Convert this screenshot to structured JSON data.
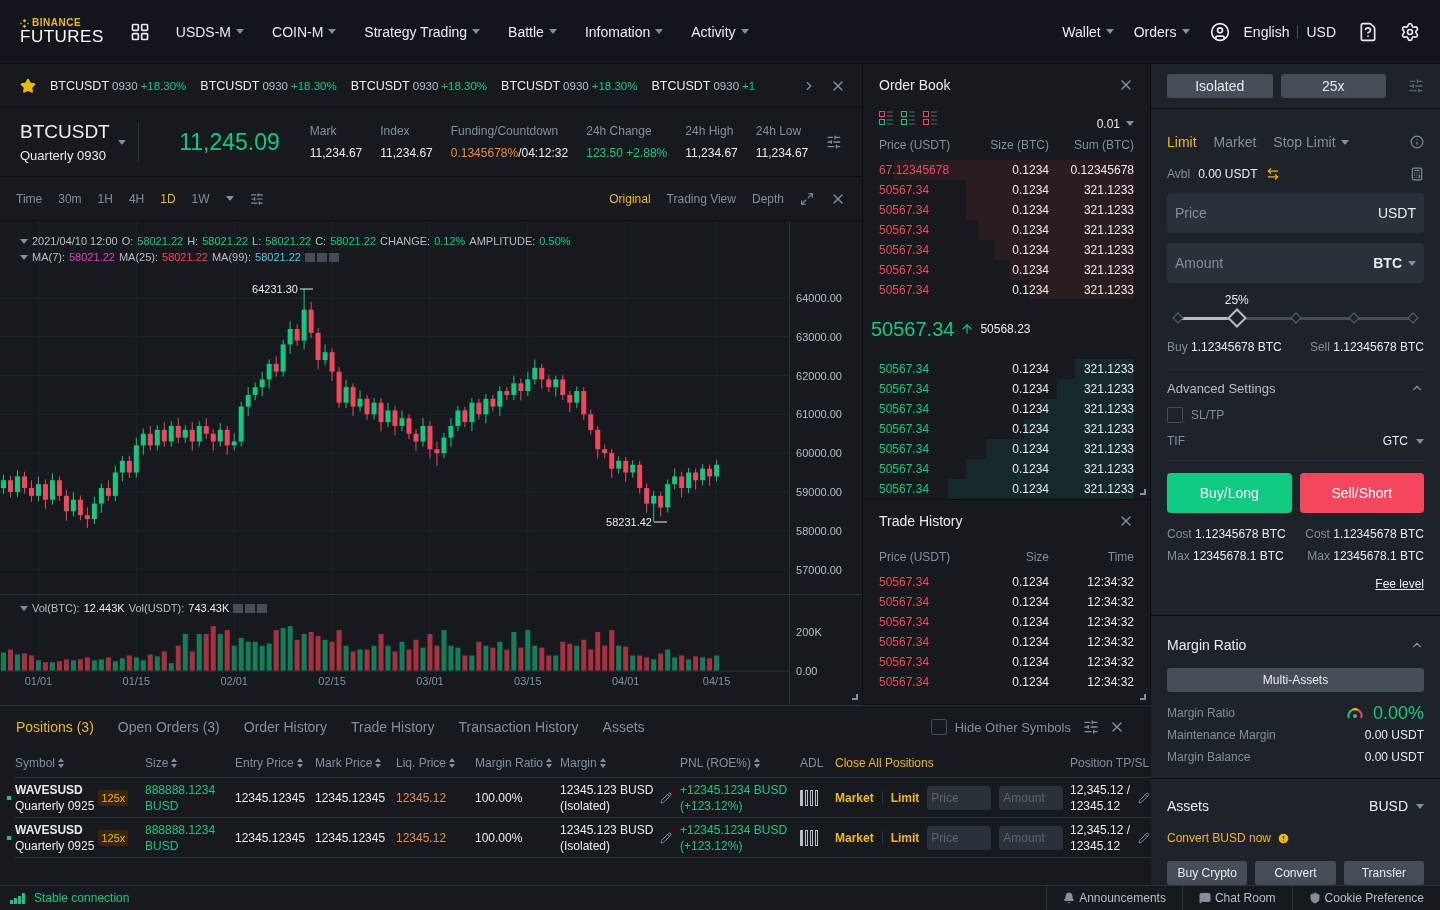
{
  "header": {
    "logo": {
      "top": "BINANCE",
      "bottom": "FUTURES"
    },
    "nav": [
      {
        "label": "USDS-M",
        "dropdown": true
      },
      {
        "label": "COIN-M",
        "dropdown": true
      },
      {
        "label": "Strategy Trading",
        "dropdown": true
      },
      {
        "label": "Battle",
        "dropdown": true
      },
      {
        "label": "Infomation",
        "dropdown": true
      },
      {
        "label": "Activity",
        "dropdown": true
      }
    ],
    "menus": [
      {
        "label": "Wallet",
        "dropdown": true
      },
      {
        "label": "Orders",
        "dropdown": true
      }
    ],
    "language": "English",
    "currency": "USD"
  },
  "ticker": {
    "favorite": true,
    "items": [
      {
        "symbol": "BTCUSDT",
        "contract": "0930",
        "change": "+18.30%"
      },
      {
        "symbol": "BTCUSDT",
        "contract": "0930",
        "change": "+18.30%"
      },
      {
        "symbol": "BTCUSDT",
        "contract": "0930",
        "change": "+18.30%"
      },
      {
        "symbol": "BTCUSDT",
        "contract": "0930",
        "change": "+18.30%"
      },
      {
        "symbol": "BTCUSDT",
        "contract": "0930",
        "change": "+1"
      }
    ]
  },
  "symbol_info": {
    "symbol": "BTCUSDT",
    "contract": "Quarterly 0930",
    "last_price": "11,245.09",
    "stats": [
      {
        "label": "Mark",
        "value": "11,234.67",
        "color": "#eaecef"
      },
      {
        "label": "Index",
        "value": "11,234.67",
        "color": "#eaecef"
      },
      {
        "label": "Funding/Countdown",
        "value": "0.1345678%",
        "suffix": "/04:12:32",
        "color": "#f0883e"
      },
      {
        "label": "24h Change",
        "value": "123.50 +2.88%",
        "color": "#0ecb81"
      },
      {
        "label": "24h High",
        "value": "11,234.67",
        "color": "#eaecef"
      },
      {
        "label": "24h Low",
        "value": "11,234.67",
        "color": "#eaecef"
      }
    ]
  },
  "chart_toolbar": {
    "intervals": [
      {
        "label": "Time",
        "selected": false
      },
      {
        "label": "30m",
        "selected": false
      },
      {
        "label": "1H",
        "selected": false
      },
      {
        "label": "4H",
        "selected": false
      },
      {
        "label": "1D",
        "selected": true
      },
      {
        "label": "1W",
        "selected": false
      }
    ],
    "views": [
      {
        "label": "Original",
        "selected": true
      },
      {
        "label": "Trading View",
        "selected": false
      },
      {
        "label": "Depth",
        "selected": false
      }
    ]
  },
  "chart": {
    "date": "2021/04/10 12:00",
    "legend": [
      {
        "label": "O:",
        "value": "58021.22"
      },
      {
        "label": "H:",
        "value": "58021.22"
      },
      {
        "label": "L:",
        "value": "58021.22"
      },
      {
        "label": "C:",
        "value": "58021.22"
      },
      {
        "label": "CHANGE:",
        "value": "0.12%"
      },
      {
        "label": "AMPLITUDE:",
        "value": "0.50%"
      }
    ],
    "ma": [
      {
        "label": "MA(7):",
        "value": "58021.22",
        "color": "#e23ec8"
      },
      {
        "label": "MA(25):",
        "value": "58021.22",
        "color": "#f6465d"
      },
      {
        "label": "MA(99):",
        "value": "58021.22",
        "color": "#3fd0e8"
      }
    ],
    "high_label": "64231.30",
    "low_label": "58231.42",
    "candles": {
      "chart_data": {
        "type": "candlestick",
        "categories": [
          null,
          null,
          null,
          null,
          null,
          null,
          null,
          null,
          null,
          null,
          null,
          null,
          null,
          null,
          null,
          null,
          null,
          null,
          null,
          null,
          null,
          null,
          null,
          null,
          null,
          null,
          null,
          null,
          null,
          null,
          null,
          null,
          null,
          null,
          null,
          null,
          null,
          null,
          null,
          null,
          null,
          null,
          null,
          null,
          null,
          null,
          null,
          null,
          null,
          null,
          null,
          null,
          null,
          null,
          null,
          null,
          null,
          null,
          null,
          null,
          null,
          null,
          null,
          null,
          null,
          null,
          null,
          null,
          null,
          null,
          null,
          null,
          null,
          null,
          null,
          null,
          null,
          null,
          null,
          null,
          null,
          null,
          null,
          null,
          null,
          null,
          null,
          null,
          null,
          null,
          null,
          null,
          null,
          null,
          null,
          null,
          null,
          null,
          null,
          null,
          null,
          null,
          null,
          null,
          null,
          null,
          null,
          null,
          null,
          null,
          null,
          null,
          null
        ],
        "ohlc": [
          [
            59100,
            59450,
            58950,
            59300
          ],
          [
            59300,
            59420,
            58860,
            59000
          ],
          [
            59000,
            59560,
            58870,
            59400
          ],
          [
            59400,
            59520,
            58960,
            59100
          ],
          [
            59100,
            59300,
            58750,
            58900
          ],
          [
            58900,
            59390,
            58760,
            59200
          ],
          [
            59200,
            59320,
            58560,
            58800
          ],
          [
            58800,
            59480,
            58670,
            59300
          ],
          [
            59300,
            59400,
            58770,
            58900
          ],
          [
            58900,
            59050,
            58260,
            58500
          ],
          [
            58500,
            58990,
            58370,
            58800
          ],
          [
            58800,
            58910,
            58270,
            58400
          ],
          [
            58400,
            58600,
            58070,
            58300
          ],
          [
            58300,
            58880,
            58170,
            58700
          ],
          [
            58700,
            59220,
            58460,
            59100
          ],
          [
            59100,
            59300,
            58770,
            58900
          ],
          [
            58900,
            59680,
            58760,
            59500
          ],
          [
            59500,
            59920,
            59270,
            59800
          ],
          [
            59800,
            59930,
            59360,
            59500
          ],
          [
            59500,
            60400,
            59370,
            60200
          ],
          [
            60200,
            60630,
            59960,
            60500
          ],
          [
            60500,
            60700,
            60070,
            60200
          ],
          [
            60200,
            60720,
            60070,
            60600
          ],
          [
            60600,
            60800,
            60160,
            60300
          ],
          [
            60300,
            60820,
            60170,
            60700
          ],
          [
            60700,
            60900,
            60260,
            60400
          ],
          [
            60400,
            60720,
            60270,
            60600
          ],
          [
            60600,
            60800,
            60060,
            60300
          ],
          [
            60300,
            60820,
            60170,
            60700
          ],
          [
            60700,
            60900,
            60370,
            60500
          ],
          [
            60500,
            60620,
            60060,
            60300
          ],
          [
            60300,
            60780,
            60170,
            60600
          ],
          [
            60600,
            60700,
            59960,
            60200
          ],
          [
            60200,
            60520,
            60070,
            60300
          ],
          [
            60300,
            61320,
            60170,
            61200
          ],
          [
            61200,
            61700,
            60960,
            61500
          ],
          [
            61500,
            61820,
            61370,
            61700
          ],
          [
            61700,
            62100,
            61470,
            61900
          ],
          [
            61900,
            62420,
            61660,
            62300
          ],
          [
            62300,
            62500,
            61970,
            62100
          ],
          [
            62100,
            62920,
            61970,
            62800
          ],
          [
            62800,
            63400,
            62560,
            63200
          ],
          [
            63200,
            63320,
            62770,
            62900
          ],
          [
            62900,
            64230,
            62670,
            63700
          ],
          [
            63700,
            63900,
            62970,
            63100
          ],
          [
            63100,
            63220,
            62160,
            62400
          ],
          [
            62400,
            62800,
            62270,
            62600
          ],
          [
            62600,
            62700,
            61860,
            62100
          ],
          [
            62100,
            62220,
            61170,
            61300
          ],
          [
            61300,
            61900,
            61160,
            61700
          ],
          [
            61700,
            61800,
            60960,
            61200
          ],
          [
            61200,
            61620,
            61070,
            61400
          ],
          [
            61400,
            61500,
            60860,
            61000
          ],
          [
            61000,
            61420,
            60870,
            61300
          ],
          [
            61300,
            61420,
            60560,
            60800
          ],
          [
            60800,
            61300,
            60670,
            61100
          ],
          [
            61100,
            61220,
            60460,
            60700
          ],
          [
            60700,
            61100,
            60570,
            60900
          ],
          [
            60900,
            61000,
            60360,
            60500
          ],
          [
            60500,
            60620,
            60060,
            60300
          ],
          [
            60300,
            60900,
            60170,
            60700
          ],
          [
            60700,
            60820,
            59860,
            60100
          ],
          [
            60100,
            60300,
            59670,
            60000
          ],
          [
            60000,
            60520,
            59870,
            60400
          ],
          [
            60400,
            60900,
            60160,
            60700
          ],
          [
            60700,
            61220,
            60570,
            61100
          ],
          [
            61100,
            61200,
            60670,
            60800
          ],
          [
            60800,
            61420,
            60570,
            61300
          ],
          [
            61300,
            61400,
            60870,
            61000
          ],
          [
            61000,
            61520,
            60770,
            61400
          ],
          [
            61400,
            61500,
            61070,
            61200
          ],
          [
            61200,
            61720,
            60960,
            61600
          ],
          [
            61600,
            61700,
            61370,
            61500
          ],
          [
            61500,
            62000,
            61370,
            61800
          ],
          [
            61800,
            61920,
            61360,
            61600
          ],
          [
            61600,
            62100,
            61470,
            61900
          ],
          [
            61900,
            62420,
            61770,
            62200
          ],
          [
            62200,
            62300,
            61660,
            61900
          ],
          [
            61900,
            62020,
            61570,
            61700
          ],
          [
            61700,
            62000,
            61460,
            61900
          ],
          [
            61900,
            62020,
            61370,
            61500
          ],
          [
            61500,
            61600,
            61060,
            61300
          ],
          [
            61300,
            61720,
            61170,
            61600
          ],
          [
            61600,
            61700,
            60860,
            61000
          ],
          [
            61000,
            61120,
            60470,
            60600
          ],
          [
            60600,
            60700,
            59860,
            60100
          ],
          [
            60100,
            60220,
            59870,
            60000
          ],
          [
            60000,
            60100,
            59360,
            59600
          ],
          [
            59600,
            59920,
            59470,
            59800
          ],
          [
            59800,
            59900,
            59260,
            59500
          ],
          [
            59500,
            59820,
            59370,
            59700
          ],
          [
            59700,
            59800,
            58960,
            59100
          ],
          [
            59100,
            59220,
            58470,
            58700
          ],
          [
            58700,
            59020,
            58230,
            58900
          ],
          [
            58900,
            59000,
            58370,
            58600
          ],
          [
            58600,
            59320,
            58470,
            59200
          ],
          [
            59200,
            59600,
            59070,
            59400
          ],
          [
            59400,
            59520,
            58860,
            59100
          ],
          [
            59100,
            59620,
            58970,
            59500
          ],
          [
            59500,
            59600,
            59060,
            59300
          ],
          [
            59300,
            59720,
            59170,
            59600
          ],
          [
            59600,
            59700,
            59160,
            59400
          ],
          [
            59400,
            59820,
            59270,
            59700
          ],
          null,
          null,
          null,
          null,
          null,
          null,
          null,
          null,
          null,
          null
        ],
        "ylim": [
          56369,
          65983.5
        ],
        "grid": true,
        "yticks": [
          {
            "value": 64000,
            "label": "64000.00"
          },
          {
            "value": 63000,
            "label": "63000.00"
          },
          {
            "value": 62000,
            "label": "62000.00"
          },
          {
            "value": 61000,
            "label": "61000.00"
          },
          {
            "value": 60000,
            "label": "60000.00"
          },
          {
            "value": 59000,
            "label": "59000.00"
          },
          {
            "value": 58000,
            "label": "58000.00"
          },
          {
            "value": 57000,
            "label": "57000.00"
          }
        ]
      }
    },
    "volume_legend": [
      {
        "label": "Vol(BTC):",
        "value": "12.443K"
      },
      {
        "label": "Vol(USDT):",
        "value": "743.43K"
      }
    ],
    "volume": {
      "chart_data": {
        "type": "bar",
        "ylim": [
          0,
          389700
        ],
        "grid": true,
        "categories": [
          null,
          null,
          null,
          null,
          null,
          "01/01",
          null,
          null,
          null,
          null,
          null,
          null,
          null,
          null,
          null,
          null,
          null,
          null,
          null,
          "01/15",
          null,
          null,
          null,
          null,
          null,
          null,
          null,
          null,
          null,
          null,
          null,
          null,
          null,
          "02/01",
          null,
          null,
          null,
          null,
          null,
          null,
          null,
          null,
          null,
          null,
          null,
          null,
          null,
          "02/15",
          null,
          null,
          null,
          null,
          null,
          null,
          null,
          null,
          null,
          null,
          null,
          null,
          null,
          "03/01",
          null,
          null,
          null,
          null,
          null,
          null,
          null,
          null,
          null,
          null,
          null,
          null,
          null,
          "03/15",
          null,
          null,
          null,
          null,
          null,
          null,
          null,
          null,
          null,
          null,
          null,
          null,
          null,
          "04/01",
          null,
          null,
          null,
          null,
          null,
          null,
          null,
          null,
          null,
          null,
          null,
          null,
          "04/15",
          null,
          null,
          null,
          null,
          null,
          null,
          null,
          null,
          null,
          null
        ],
        "series": [
          {
            "color": "#10805a",
            "values": [
              95000,
              null,
              85000,
              null,
              null,
              55000,
              null,
              45000,
              null,
              null,
              55000,
              null,
              null,
              55000,
              60000,
              null,
              50000,
              65000,
              null,
              70000,
              55000,
              null,
              75000,
              null,
              40000,
              null,
              190000,
              null,
              190000,
              null,
              null,
              190000,
              null,
              130000,
              170000,
              150000,
              150000,
              130000,
              140000,
              null,
              220000,
              230000,
              null,
              190000,
              null,
              null,
              160000,
              null,
              null,
              130000,
              null,
              110000,
              null,
              130000,
              null,
              130000,
              null,
              150000,
              null,
              null,
              120000,
              null,
              null,
              210000,
              130000,
              120000,
              null,
              80000,
              null,
              130000,
              null,
              150000,
              null,
              200000,
              null,
              210000,
              130000,
              null,
              null,
              80000,
              null,
              null,
              130000,
              null,
              null,
              null,
              null,
              null,
              130000,
              null,
              80000,
              null,
              null,
              60000,
              null,
              110000,
              70000,
              null,
              60000,
              null,
              70000,
              null,
              80000,
              null,
              null,
              null,
              null,
              null,
              null,
              null,
              null,
              null,
              null
            ]
          },
          {
            "color": "#a8303f",
            "values": [
              null,
              110000,
              null,
              90000,
              80000,
              null,
              45000,
              null,
              50000,
              60000,
              null,
              60000,
              70000,
              null,
              null,
              70000,
              null,
              null,
              80000,
              null,
              null,
              85000,
              null,
              100000,
              null,
              130000,
              null,
              100000,
              null,
              190000,
              230000,
              null,
              210000,
              null,
              null,
              null,
              null,
              null,
              null,
              210000,
              null,
              null,
              160000,
              null,
              200000,
              180000,
              null,
              150000,
              210000,
              null,
              100000,
              null,
              110000,
              null,
              190000,
              null,
              100000,
              null,
              110000,
              160000,
              null,
              190000,
              130000,
              null,
              null,
              null,
              80000,
              null,
              150000,
              null,
              120000,
              null,
              110000,
              null,
              120000,
              null,
              null,
              120000,
              80000,
              null,
              150000,
              140000,
              null,
              160000,
              110000,
              200000,
              130000,
              210000,
              null,
              125000,
              null,
              80000,
              70000,
              null,
              90000,
              null,
              null,
              80000,
              null,
              75000,
              null,
              65000,
              null,
              null,
              null,
              null,
              null,
              null,
              null,
              null,
              null,
              null,
              null
            ]
          }
        ],
        "yticks": [
          {
            "value": 200000,
            "label": "200K"
          },
          {
            "value": 0,
            "label": "0.00"
          }
        ]
      }
    }
  },
  "order_book": {
    "title": "Order Book",
    "precision": "0.01",
    "columns": [
      "Price (USDT)",
      "Size (BTC)",
      "Sum (BTC)"
    ],
    "asks": [
      {
        "price": "67.12345678",
        "size": "0.1234",
        "sum": "0.12345678"
      },
      {
        "price": "50567.34",
        "size": "0.1234",
        "sum": "321.1233"
      },
      {
        "price": "50567.34",
        "size": "0.1234",
        "sum": "321.1233"
      },
      {
        "price": "50567.34",
        "size": "0.1234",
        "sum": "321.1233"
      },
      {
        "price": "50567.34",
        "size": "0.1234",
        "sum": "321.1233"
      },
      {
        "price": "50567.34",
        "size": "0.1234",
        "sum": "321.1233"
      },
      {
        "price": "50567.34",
        "size": "0.1234",
        "sum": "321.1233"
      }
    ],
    "last_price": "50567.34",
    "mark_price": "50568.23",
    "bids": [
      {
        "price": "50567.34",
        "size": "0.1234",
        "sum": "321.1233"
      },
      {
        "price": "50567.34",
        "size": "0.1234",
        "sum": "321.1233"
      },
      {
        "price": "50567.34",
        "size": "0.1234",
        "sum": "321.1233"
      },
      {
        "price": "50567.34",
        "size": "0.1234",
        "sum": "321.1233"
      },
      {
        "price": "50567.34",
        "size": "0.1234",
        "sum": "321.1233"
      },
      {
        "price": "50567.34",
        "size": "0.1234",
        "sum": "321.1233"
      },
      {
        "price": "50567.34",
        "size": "0.1234",
        "sum": "321.1233"
      }
    ]
  },
  "trade_history": {
    "title": "Trade History",
    "columns": [
      "Price (USDT)",
      "Size",
      "Time"
    ],
    "rows": [
      {
        "price": "50567.34",
        "size": "0.1234",
        "time": "12:34:32"
      },
      {
        "price": "50567.34",
        "size": "0.1234",
        "time": "12:34:32"
      },
      {
        "price": "50567.34",
        "size": "0.1234",
        "time": "12:34:32"
      },
      {
        "price": "50567.34",
        "size": "0.1234",
        "time": "12:34:32"
      },
      {
        "price": "50567.34",
        "size": "0.1234",
        "time": "12:34:32"
      },
      {
        "price": "50567.34",
        "size": "0.1234",
        "time": "12:34:32"
      }
    ]
  },
  "order_form": {
    "margin_mode": "Isolated",
    "leverage": "25x",
    "order_types": [
      {
        "label": "Limit",
        "selected": true,
        "dropdown": false
      },
      {
        "label": "Market",
        "selected": false,
        "dropdown": false
      },
      {
        "label": "Stop Limit",
        "selected": false,
        "dropdown": true
      }
    ],
    "available_label": "Avbl",
    "available": "0.00 USDT",
    "price_field": {
      "placeholder": "Price",
      "unit": "USDT"
    },
    "amount_field": {
      "placeholder": "Amount",
      "unit": "BTC"
    },
    "slider": {
      "level": 0.25,
      "reading": "25%"
    },
    "buy_label": "Buy",
    "buy_value": "1.12345678 BTC",
    "sell_label": "Sell",
    "sell_value": "1.12345678 BTC",
    "advanced": {
      "title": "Advanced Settings",
      "expanded": true
    },
    "sltp": {
      "label": "SL/TP",
      "checked": false
    },
    "tif": {
      "label": "TIF",
      "value": "GTC"
    },
    "buy_button": "Buy/Long",
    "sell_button": "Sell/Short",
    "costs": [
      {
        "label": "Cost",
        "value": "1.12345678 BTC"
      },
      {
        "label": "Cost",
        "value": "1.12345678 BTC"
      }
    ],
    "maxes": [
      {
        "label": "Max",
        "value": "12345678.1 BTC"
      },
      {
        "label": "Max",
        "value": "12345678.1 BTC"
      }
    ],
    "fee_link": "Fee level"
  },
  "margin_ratio": {
    "title": "Margin Ratio",
    "expanded": true,
    "mode_button": "Multi-Assets",
    "rows": [
      {
        "label": "Margin Ratio",
        "value": "0.00%",
        "kind": "ratio"
      },
      {
        "label": "Maintenance Margin",
        "value": "0.00 USDT",
        "kind": "plain"
      },
      {
        "label": "Margin Balance",
        "value": "0.00 USDT",
        "kind": "plain"
      }
    ]
  },
  "assets": {
    "title": "Assets",
    "currency": "BUSD",
    "convert_link": "Convert BUSD now",
    "buttons": [
      "Buy Crypto",
      "Convert",
      "Transfer"
    ]
  },
  "positions": {
    "tabs": [
      {
        "label": "Positions (3)",
        "selected": true
      },
      {
        "label": "Open Orders (3)",
        "selected": false
      },
      {
        "label": "Order History",
        "selected": false
      },
      {
        "label": "Trade History",
        "selected": false
      },
      {
        "label": "Transaction History",
        "selected": false
      },
      {
        "label": "Assets",
        "selected": false
      }
    ],
    "hide_other": {
      "label": "Hide Other Symbols",
      "checked": false
    },
    "columns": [
      {
        "label": "Symbol",
        "kind": "sort"
      },
      {
        "label": "Size",
        "kind": "sort"
      },
      {
        "label": "Entry Price",
        "kind": "sort"
      },
      {
        "label": "Mark Price",
        "kind": "sort"
      },
      {
        "label": "Liq. Price",
        "kind": "sort"
      },
      {
        "label": "Margin Ratio",
        "kind": "sort"
      },
      {
        "label": "Margin",
        "kind": "sort"
      },
      {
        "label": "PNL (ROE%)",
        "kind": "sort"
      },
      {
        "label": "ADL",
        "kind": "plain"
      },
      {
        "label": "Close All Positions",
        "kind": "link"
      },
      {
        "label": "Position TP/SL",
        "kind": "plain"
      }
    ],
    "rows": [
      {
        "symbol": "WAVESUSD",
        "contract": "Quarterly 0925",
        "leverage": "125x",
        "size": "888888.1234 BUSD",
        "entry": "12345.12345",
        "mark": "12345.12345",
        "liq": "12345.12",
        "ratio": "100.00%",
        "margin": "12345.123 BUSD (Isolated)",
        "pnl": "+12345.1234 BUSD (+123.12%)",
        "market": "Market",
        "limit": "Limit",
        "price_placeholder": "Price",
        "amount_placeholder": "Amount",
        "tpsl": "12,345.12 / 12345.12"
      },
      {
        "symbol": "WAVESUSD",
        "contract": "Quarterly 0925",
        "leverage": "125x",
        "size": "888888.1234 BUSD",
        "entry": "12345.12345",
        "mark": "12345.12345",
        "liq": "12345.12",
        "ratio": "100.00%",
        "margin": "12345.123 BUSD (Isolated)",
        "pnl": "+12345.1234 BUSD (+123.12%)",
        "market": "Market",
        "limit": "Limit",
        "price_placeholder": "Price",
        "amount_placeholder": "Amount",
        "tpsl": "12,345.12 / 12345.12"
      }
    ]
  },
  "status_bar": {
    "connection": "Stable connection",
    "links": [
      "Announcements",
      "Chat Room",
      "Cookie Preference"
    ]
  }
}
